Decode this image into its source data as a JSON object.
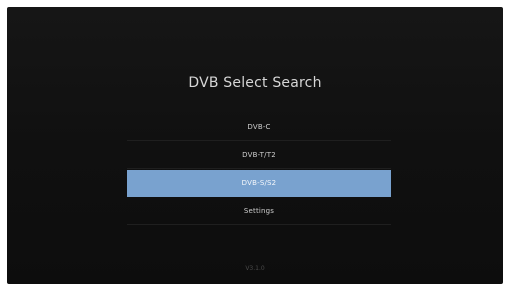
{
  "screen": {
    "title": "DVB Select Search",
    "version": "V3.1.0",
    "menu": {
      "items": [
        {
          "label": "DVB-C",
          "selected": false
        },
        {
          "label": "DVB-T/T2",
          "selected": false
        },
        {
          "label": "DVB-S/S2",
          "selected": true
        },
        {
          "label": "Settings",
          "selected": false
        }
      ]
    },
    "colors": {
      "background": "#121212",
      "selected_highlight": "#79a2cf",
      "text": "#d6d6d6"
    }
  }
}
